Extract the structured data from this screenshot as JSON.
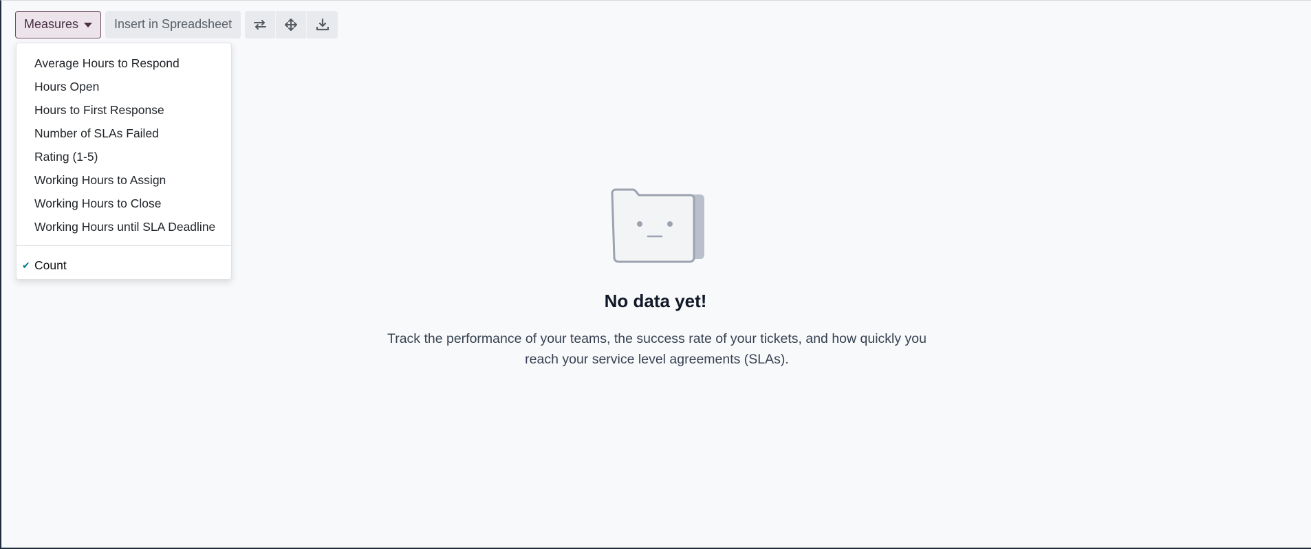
{
  "toolbar": {
    "measures_label": "Measures",
    "insert_label": "Insert in Spreadsheet",
    "icons": [
      "flip-axis-icon",
      "expand-icon",
      "download-icon"
    ]
  },
  "measures_menu": {
    "items": [
      "Average Hours to Respond",
      "Hours Open",
      "Hours to First Response",
      "Number of SLAs Failed",
      "Rating (1-5)",
      "Working Hours to Assign",
      "Working Hours to Close",
      "Working Hours until SLA Deadline"
    ],
    "checked_item": "Count"
  },
  "empty_state": {
    "title": "No data yet!",
    "text": "Track the performance of your teams, the success rate of your tickets, and how quickly you reach your service level agreements (SLAs)."
  },
  "colors": {
    "accent": "#714b67",
    "check": "#017e84",
    "background": "#f8f9fb"
  }
}
